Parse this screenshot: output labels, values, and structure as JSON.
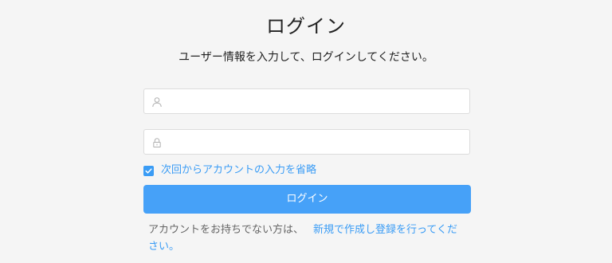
{
  "login": {
    "title": "ログイン",
    "subtitle": "ユーザー情報を入力して、ログインしてください。",
    "username": {
      "value": "",
      "placeholder": "",
      "icon": "user-icon"
    },
    "password": {
      "value": "",
      "placeholder": "",
      "icon": "lock-icon"
    },
    "remember": {
      "checked": true,
      "label": "次回からアカウントの入力を省略"
    },
    "submit_label": "ログイン",
    "register": {
      "prefix": "アカウントをお持ちでない方は、",
      "link_text": "新規で作成し登録を行ってください。"
    }
  },
  "colors": {
    "background": "#f5f5f5",
    "accent": "#3a9cf5",
    "button": "#46a1f8"
  }
}
